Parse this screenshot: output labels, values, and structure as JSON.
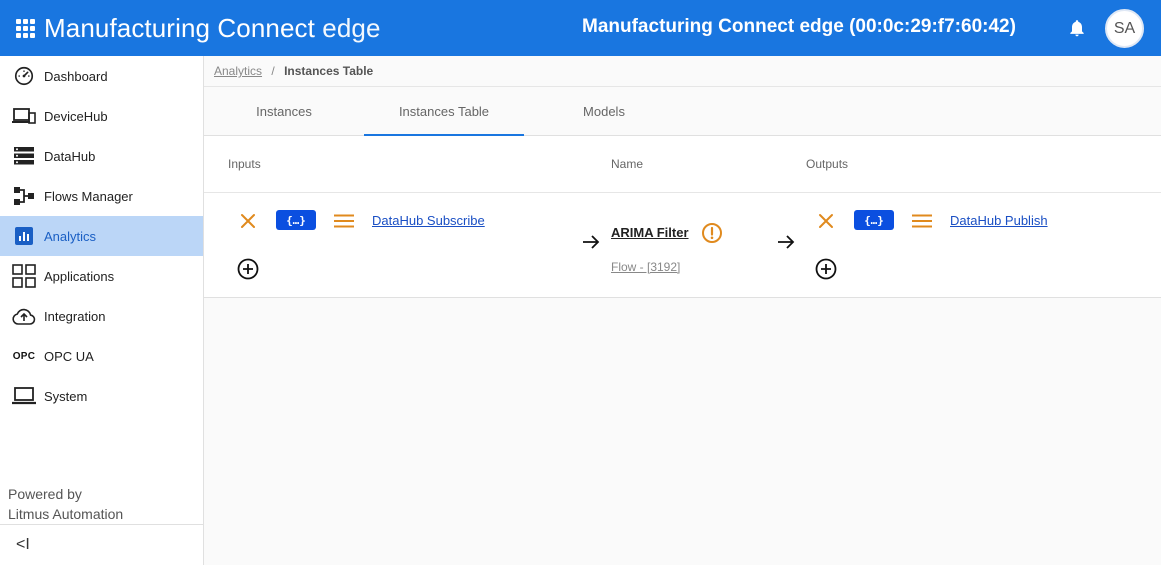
{
  "header": {
    "brand": "Manufacturing Connect",
    "brand_suffix": "edge",
    "device_title": "Manufacturing Connect edge (00:0c:29:f7:60:42)",
    "avatar_initials": "SA",
    "color": "#1976e0"
  },
  "sidebar": {
    "items": [
      {
        "label": "Dashboard",
        "icon": "speedometer-icon"
      },
      {
        "label": "DeviceHub",
        "icon": "devices-icon"
      },
      {
        "label": "DataHub",
        "icon": "server-icon"
      },
      {
        "label": "Flows Manager",
        "icon": "flows-icon"
      },
      {
        "label": "Analytics",
        "icon": "chart-icon",
        "active": true
      },
      {
        "label": "Applications",
        "icon": "apps-grid-icon"
      },
      {
        "label": "Integration",
        "icon": "cloud-upload-icon"
      },
      {
        "label": "OPC UA",
        "icon": "opc-icon",
        "icon_text": "OPC"
      },
      {
        "label": "System",
        "icon": "laptop-icon"
      }
    ],
    "powered_by_line1": "Powered by",
    "powered_by_line2": "Litmus Automation",
    "collapse_label": "<I"
  },
  "breadcrumb": {
    "parent": "Analytics",
    "separator": "/",
    "current": "Instances Table"
  },
  "tabs": [
    {
      "label": "Instances"
    },
    {
      "label": "Instances Table",
      "active": true
    },
    {
      "label": "Models"
    }
  ],
  "table": {
    "headers": {
      "inputs": "Inputs",
      "name": "Name",
      "outputs": "Outputs"
    },
    "rows": [
      {
        "input": {
          "chip": "{…}",
          "link": "DataHub Subscribe"
        },
        "name": "ARIMA Filter",
        "flow": "Flow - [3192]",
        "output": {
          "chip": "{…}",
          "link": "DataHub Publish"
        }
      }
    ]
  },
  "colors": {
    "accent": "#1976e0",
    "warning": "#e08a1e",
    "chip": "#0b4fe0",
    "active_nav_bg": "#bbd6f7"
  }
}
